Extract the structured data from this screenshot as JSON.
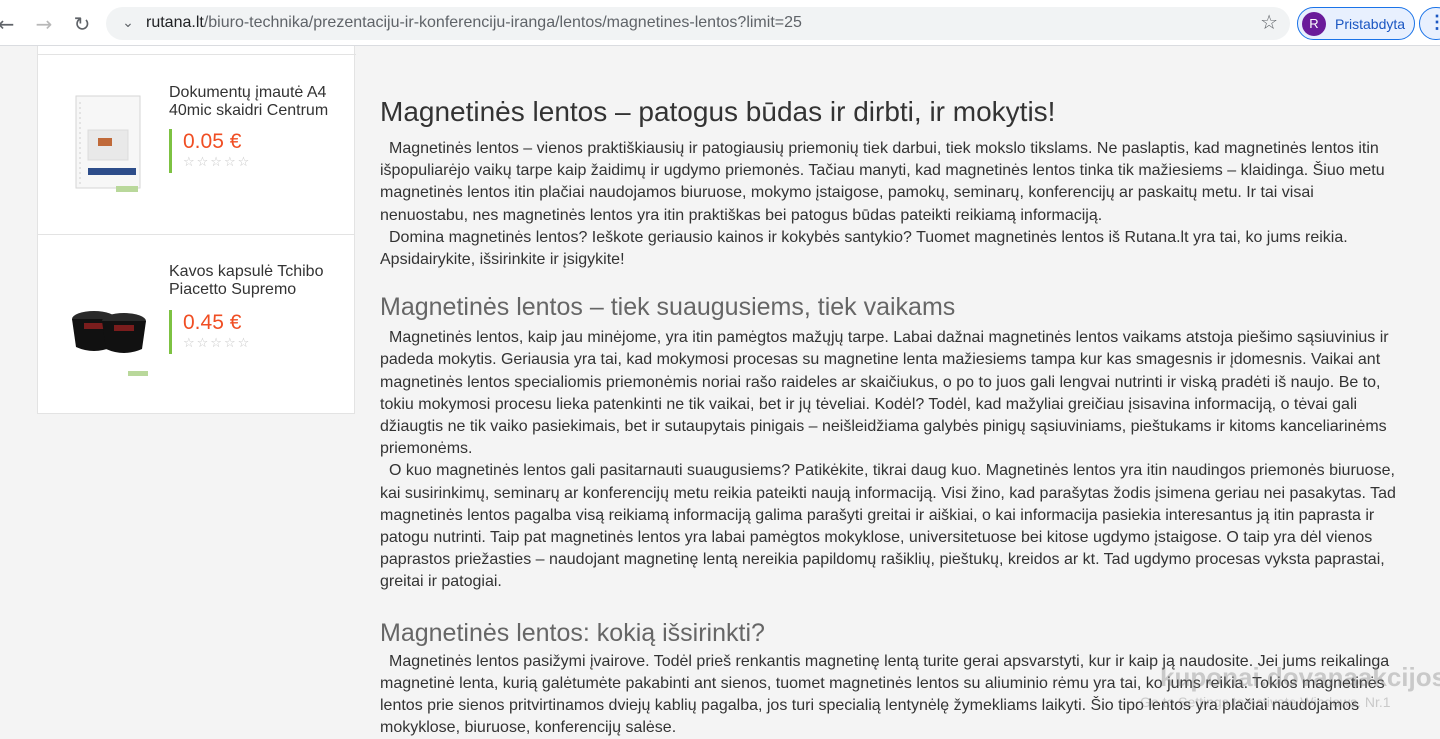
{
  "browser": {
    "url_host": "rutana.lt",
    "url_path": "/biuro-technika/prezentaciju-ir-konferenciju-iranga/lentos/magnetines-lentos?limit=25",
    "profile_initial": "R",
    "profile_label": "Pristabdyta"
  },
  "sidebar": {
    "products": [
      {
        "name": "Dokumentų įmautė A4 40mic skaidri Centrum",
        "price": "0.05 €",
        "rating": 0
      },
      {
        "name": "Kavos kapsulė Tchibo Piacetto Supremo",
        "price": "0.45 €",
        "rating": 0
      }
    ]
  },
  "article": {
    "title": "Magnetinės lentos – patogus būdas ir dirbti, ir mokytis!",
    "intro_p1": "Magnetinės lentos – vienos praktiškiausių ir patogiausių priemonių tiek darbui, tiek mokslo tikslams. Ne paslaptis, kad magnetinės lentos itin išpopuliarėjo vaikų tarpe kaip žaidimų ir ugdymo priemonės. Tačiau manyti, kad magnetinės lentos tinka tik mažiesiems – klaidinga. Šiuo metu magnetinės lentos itin plačiai naudojamos biuruose, mokymo įstaigose, pamokų, seminarų, konferencijų ar paskaitų metu. Ir tai visai nenuostabu, nes magnetinės lentos yra itin praktiškas bei patogus būdas pateikti reikiamą informaciją.",
    "intro_p2": "Domina magnetinės lentos? Ieškote geriausio kainos ir kokybės santykio? Tuomet magnetinės lentos iš Rutana.lt yra tai, ko jums reikia. Apsidairykite, išsirinkite ir įsigykite!",
    "section1_title": "Magnetinės lentos – tiek suaugusiems, tiek vaikams",
    "section1_p1": "Magnetinės lentos, kaip jau minėjome, yra itin pamėgtos mažųjų tarpe. Labai dažnai magnetinės lentos vaikams atstoja piešimo sąsiuvinius ir padeda mokytis. Geriausia yra tai, kad mokymosi procesas su magnetine lenta mažiesiems tampa kur kas smagesnis ir įdomesnis. Vaikai ant magnetinės lentos specialiomis priemonėmis noriai rašo raideles ar skaičiukus, o po to juos gali lengvai nutrinti ir viską pradėti iš naujo. Be to, tokiu mokymosi procesu lieka patenkinti ne tik vaikai, bet ir jų tėveliai. Kodėl? Todėl, kad mažyliai greičiau įsisavina informaciją, o tėvai gali džiaugtis ne tik vaiko pasiekimais, bet ir sutaupytais pinigais – neišleidžiama galybės pinigų sąsiuviniams, pieštukams ir kitoms kanceliarinėms priemonėms.",
    "section1_p2": "O kuo magnetinės lentos gali pasitarnauti suaugusiems? Patikėkite, tikrai daug kuo. Magnetinės lentos yra itin naudingos priemonės biuruose, kai susirinkimų, seminarų ar konferencijų metu reikia pateikti naują informaciją. Visi žino, kad parašytas žodis įsimena geriau nei pasakytas. Tad magnetinės lentos pagalba visą reikiamą informaciją galima parašyti greitai ir aiškiai, o kai informacija pasiekia interesantus ją itin paprasta ir patogu nutrinti. Taip pat magnetinės lentos yra labai pamėgtos mokyklose, universitetuose bei kitose ugdymo įstaigose. O taip yra dėl vienos paprastos priežasties – naudojant magnetinę lentą nereikia papildomų rašiklių, pieštukų, kreidos ar kt. Tad  ugdymo procesas vyksta paprastai, greitai ir patogiai.",
    "section2_title": "Magnetinės lentos: kokią išsirinkti?",
    "section2_p1": "Magnetinės lentos pasižymi įvairove. Todėl prieš renkantis magnetinę lentą turite gerai apsvarstyti, kur ir kaip ją naudosite. Jei jums reikalinga magnetinė lenta, kurią galėtumėte pakabinti ant sienos, tuomet magnetinės lentos su aliuminio rėmu yra tai, ko jums reikia. Tokios magnetinės lentos prie sienos pritvirtinamos dviejų kablių pagalba, jos turi specialią lentynėlę žymekliams laikyti. Šio tipo lentos yra plačiai naudojamos mokyklose, biuruose, konferencijų salėse."
  },
  "watermark": {
    "line1": "kuponai.dovanaakcijos.lt",
    "line2": "Go to Settings to activate Windows. Nr.1"
  }
}
